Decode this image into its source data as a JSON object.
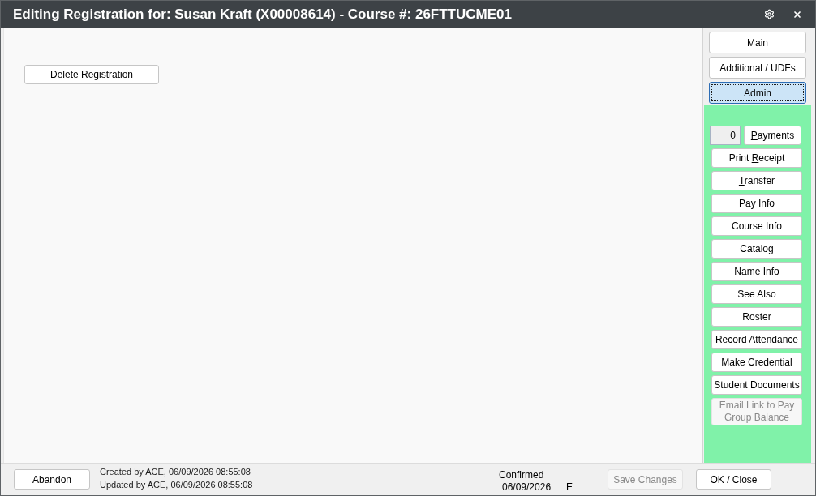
{
  "window": {
    "title": "Editing Registration for: Susan Kraft (X00008614) - Course #: 26FTTUCME01"
  },
  "actions": [
    {
      "label": "Delete Registration",
      "disabled": false
    }
  ],
  "tabs": [
    {
      "label": "Main",
      "selected": false
    },
    {
      "label": "Additional / UDFs",
      "selected": false
    },
    {
      "label": "Admin",
      "selected": true
    }
  ],
  "side_panel": {
    "payments": {
      "count": "0",
      "label": {
        "key": "P",
        "after": "ayments"
      },
      "disabled": false
    },
    "buttons": [
      {
        "label": {
          "before": "Print ",
          "key": "R",
          "after": "eceipt"
        },
        "disabled": false
      },
      {
        "label": {
          "key": "T",
          "after": "ransfer"
        },
        "disabled": false
      },
      {
        "label": {
          "before": "Pay Info"
        },
        "disabled": false
      },
      {
        "label": {
          "before": "Course Info"
        },
        "disabled": false
      },
      {
        "label": {
          "before": "Catalog"
        },
        "disabled": false
      },
      {
        "label": {
          "before": "Name Info"
        },
        "disabled": false
      },
      {
        "label": {
          "before": "See Also"
        },
        "disabled": false
      },
      {
        "label": {
          "before": "Roster"
        },
        "disabled": false
      },
      {
        "label": {
          "before": "Record Attendance"
        },
        "disabled": false
      },
      {
        "label": {
          "before": "Make Credential"
        },
        "disabled": false
      },
      {
        "label": {
          "before": "Student Documents"
        },
        "disabled": false
      },
      {
        "label": {
          "before": "Email Link to Pay Group Balance"
        },
        "disabled": true
      }
    ]
  },
  "footer": {
    "abandon": {
      "label": "Abandon",
      "disabled": false
    },
    "created": "Created by ACE, 06/09/2026 08:55:08",
    "updated": "Updated by ACE, 06/09/2026 08:55:08",
    "status": "Confirmed",
    "status_date": "06/09/2026",
    "status_code": "E",
    "save": {
      "label": "Save Changes",
      "disabled": true
    },
    "ok": {
      "label": "OK / Close",
      "disabled": false
    }
  }
}
